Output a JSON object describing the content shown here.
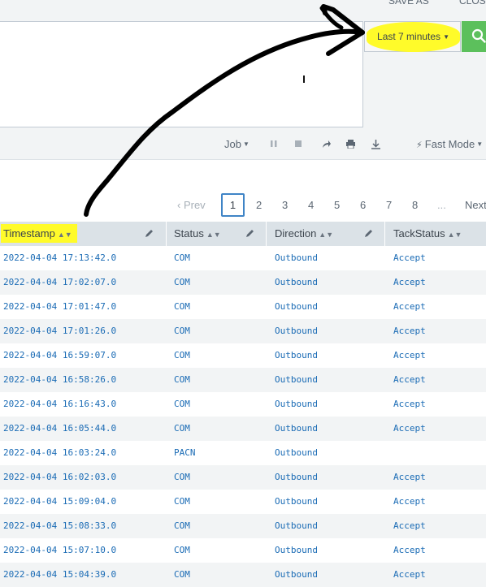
{
  "top_fragments": [
    "SAVE AS",
    "CLOSE"
  ],
  "time_picker": {
    "label": "Last 7 minutes"
  },
  "toolbar": {
    "job_label": "Job",
    "fast_mode_label": "Fast Mode"
  },
  "pagination": {
    "prev_label": "‹ Prev",
    "pages": [
      "1",
      "2",
      "3",
      "4",
      "5",
      "6",
      "7",
      "8"
    ],
    "active_page": "1",
    "ellipsis": "...",
    "next_label": "Next"
  },
  "table": {
    "columns": [
      "Timestamp",
      "Status",
      "Direction",
      "TackStatus"
    ],
    "rows": [
      [
        "2022-04-04 17:13:42.0",
        "COM",
        "Outbound",
        "Accept"
      ],
      [
        "2022-04-04 17:02:07.0",
        "COM",
        "Outbound",
        "Accept"
      ],
      [
        "2022-04-04 17:01:47.0",
        "COM",
        "Outbound",
        "Accept"
      ],
      [
        "2022-04-04 17:01:26.0",
        "COM",
        "Outbound",
        "Accept"
      ],
      [
        "2022-04-04 16:59:07.0",
        "COM",
        "Outbound",
        "Accept"
      ],
      [
        "2022-04-04 16:58:26.0",
        "COM",
        "Outbound",
        "Accept"
      ],
      [
        "2022-04-04 16:16:43.0",
        "COM",
        "Outbound",
        "Accept"
      ],
      [
        "2022-04-04 16:05:44.0",
        "COM",
        "Outbound",
        "Accept"
      ],
      [
        "2022-04-04 16:03:24.0",
        "PACN",
        "Outbound",
        ""
      ],
      [
        "2022-04-04 16:02:03.0",
        "COM",
        "Outbound",
        "Accept"
      ],
      [
        "2022-04-04 15:09:04.0",
        "COM",
        "Outbound",
        "Accept"
      ],
      [
        "2022-04-04 15:08:33.0",
        "COM",
        "Outbound",
        "Accept"
      ],
      [
        "2022-04-04 15:07:10.0",
        "COM",
        "Outbound",
        "Accept"
      ],
      [
        "2022-04-04 15:04:39.0",
        "COM",
        "Outbound",
        "Accept"
      ]
    ]
  },
  "colors": {
    "link": "#1a6bb5",
    "highlight": "#fffb2a",
    "search_button": "#5cc05c",
    "active_page_border": "#3f84c6"
  }
}
